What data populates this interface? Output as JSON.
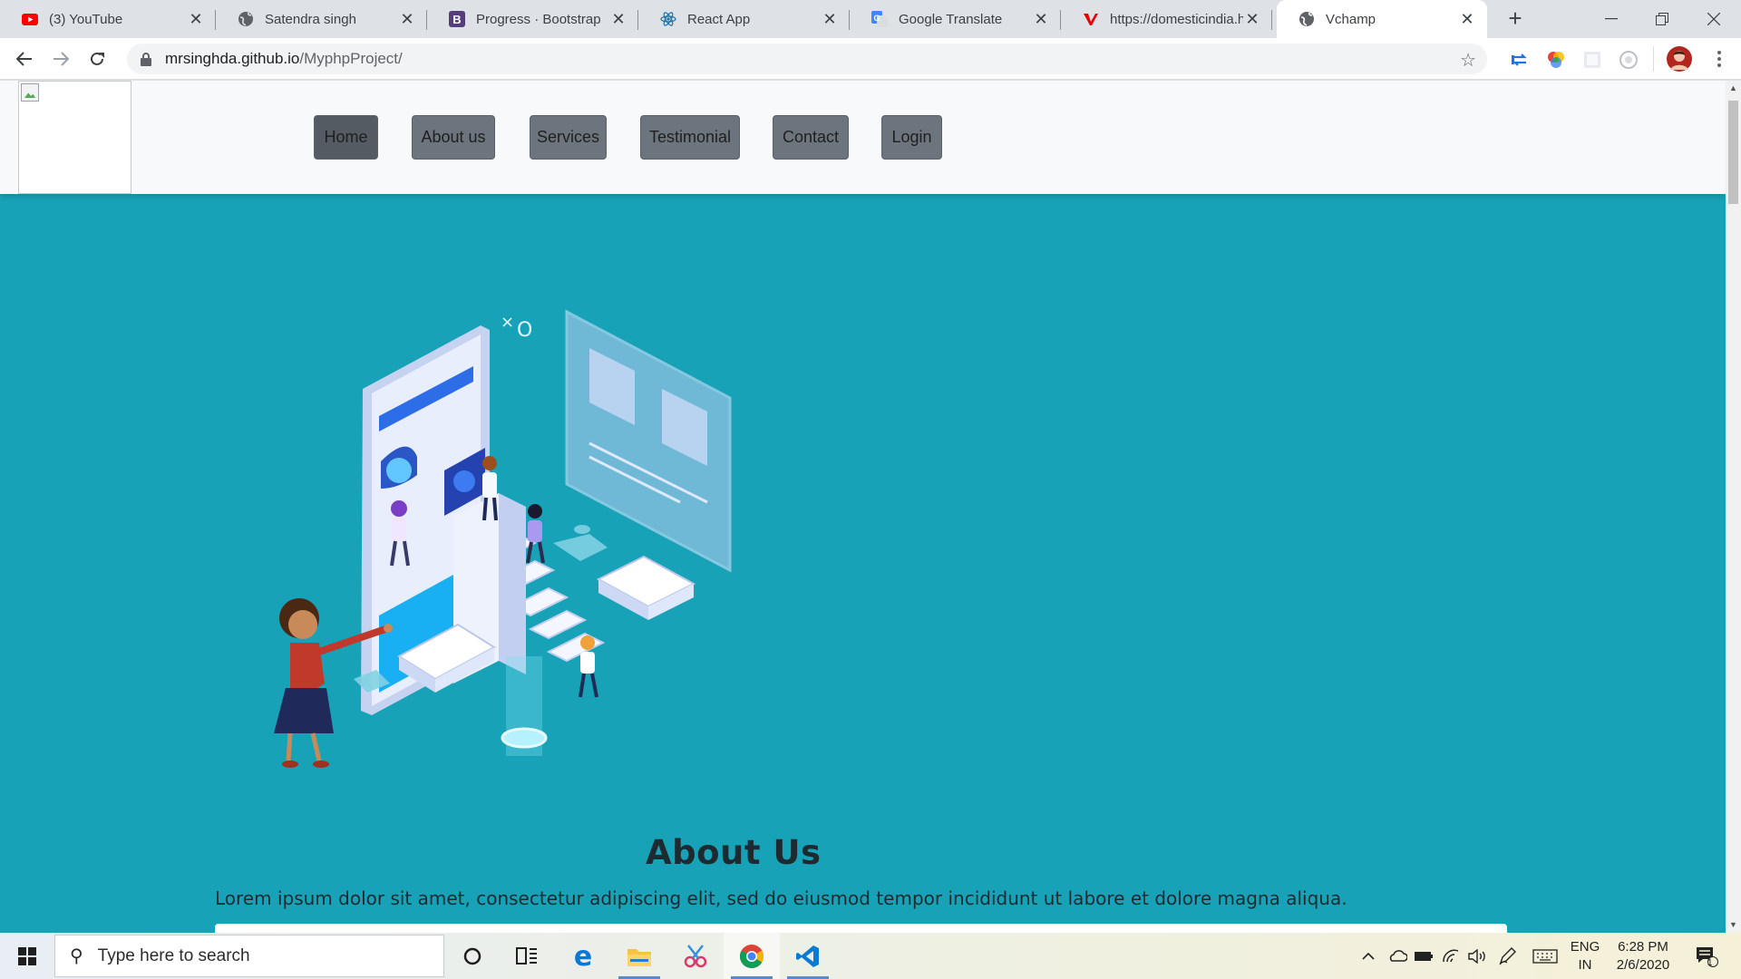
{
  "browser": {
    "tabs": [
      {
        "title": "(3) YouTube",
        "icon": "youtube-icon",
        "active": false
      },
      {
        "title": "Satendra singh",
        "icon": "globe-icon",
        "active": false
      },
      {
        "title": "Progress · Bootstrap",
        "icon": "bootstrap-icon",
        "active": false
      },
      {
        "title": "React App",
        "icon": "react-icon",
        "active": false
      },
      {
        "title": "Google Translate",
        "icon": "google-translate-icon",
        "active": false
      },
      {
        "title": "https://domesticindia.h",
        "icon": "vodafone-icon",
        "active": false
      },
      {
        "title": "Vchamp",
        "icon": "globe-icon",
        "active": true
      }
    ],
    "address": {
      "host": "mrsinghda.github.io",
      "path": "/MyphpProject/"
    }
  },
  "site": {
    "nav": [
      "Home",
      "About us",
      "Services",
      "Testimonial",
      "Contact",
      "Login"
    ],
    "active_nav": "Home",
    "about_title": "About Us",
    "about_text": "Lorem ipsum dolor sit amet, consectetur adipiscing elit, sed do eiusmod tempor incididunt ut labore et dolore magna aliqua.",
    "hero_bg": "#18a2b8"
  },
  "taskbar": {
    "search_placeholder": "Type here to search",
    "lang_line1": "ENG",
    "lang_line2": "IN",
    "time": "6:28 PM",
    "date": "2/6/2020",
    "notification_count": "1"
  }
}
